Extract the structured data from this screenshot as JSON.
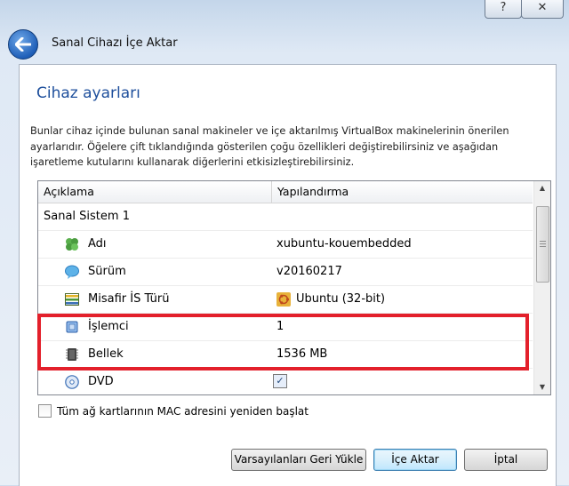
{
  "window": {
    "help_label": "?",
    "close_label": "✕",
    "wizard_title": "Sanal Cihazı İçe Aktar"
  },
  "page": {
    "heading": "Cihaz ayarları",
    "description": "Bunlar cihaz içinde bulunan sanal makineler ve içe aktarılmış VirtualBox makinelerinin önerilen ayarlarıdır. Öğelere çift tıklandığında gösterilen çoğu özellikleri değiştirebilirsiniz ve aşağıdan işaretleme kutularını kullanarak diğerlerini etkisizleştirebilirsiniz."
  },
  "table": {
    "columns": [
      "Açıklama",
      "Yapılandırma"
    ],
    "group_label": "Sanal Sistem 1",
    "rows": [
      {
        "icon": "name-icon",
        "label": "Adı",
        "value": "xubuntu-kouembedded"
      },
      {
        "icon": "version-icon",
        "label": "Sürüm",
        "value": "v20160217"
      },
      {
        "icon": "os-type-icon",
        "label": "Misafir İS Türü",
        "value": "Ubuntu (32-bit)"
      },
      {
        "icon": "cpu-icon",
        "label": "İşlemci",
        "value": "1"
      },
      {
        "icon": "memory-icon",
        "label": "Bellek",
        "value": "1536 MB"
      },
      {
        "icon": "dvd-icon",
        "label": "DVD",
        "value_checked": true
      }
    ]
  },
  "options": {
    "reinit_mac_label": "Tüm ağ kartlarının MAC adresini yeniden başlat",
    "reinit_mac_checked": false
  },
  "buttons": {
    "restore_defaults": "Varsayılanları Geri Yükle",
    "import": "İçe Aktar",
    "cancel": "İptal"
  },
  "colors": {
    "highlight_box": "#e3202b",
    "heading": "#1e4f9c"
  }
}
